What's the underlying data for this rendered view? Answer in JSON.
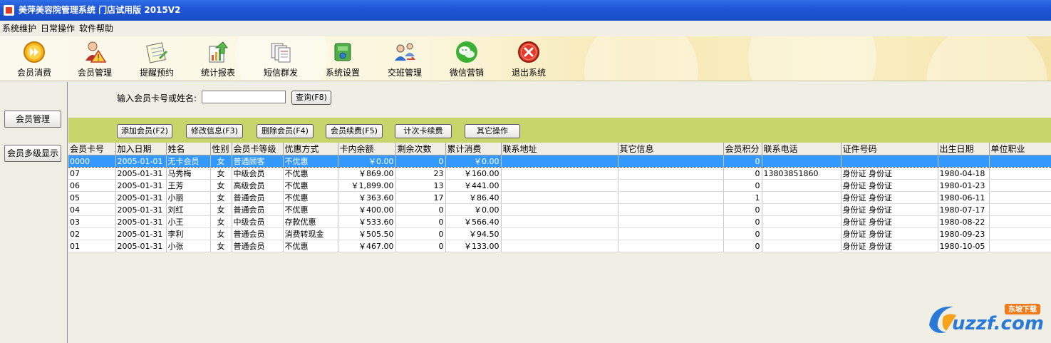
{
  "window": {
    "title": "美萍美容院管理系统 门店试用版  2015V2"
  },
  "menu": [
    "系统维护",
    "日常操作",
    "软件帮助"
  ],
  "toolbar": [
    {
      "label": "会员消费",
      "icon": "play-circle-icon"
    },
    {
      "label": "会员管理",
      "icon": "user-warning-icon"
    },
    {
      "label": "提醒预约",
      "icon": "notepad-icon"
    },
    {
      "label": "统计报表",
      "icon": "chart-arrow-icon"
    },
    {
      "label": "短信群发",
      "icon": "documents-stack-icon"
    },
    {
      "label": "系统设置",
      "icon": "settings-puzzle-icon"
    },
    {
      "label": "交班管理",
      "icon": "swap-users-icon"
    },
    {
      "label": "微信营销",
      "icon": "wechat-icon"
    },
    {
      "label": "退出系统",
      "icon": "close-circle-icon"
    }
  ],
  "sidebar": [
    "会员管理",
    "会员多级显示"
  ],
  "search": {
    "label": "输入会员卡号或姓名:",
    "value": "",
    "query_button": "查询(F8)"
  },
  "actions": [
    "添加会员(F2)",
    "修改信息(F3)",
    "删除会员(F4)",
    "会员续费(F5)",
    "计次卡续费",
    "其它操作"
  ],
  "table": {
    "columns": [
      "会员卡号",
      "加入日期",
      "姓名",
      "性别",
      "会员卡等级",
      "优惠方式",
      "卡内余额",
      "剩余次数",
      "累计消费",
      "联系地址",
      "其它信息",
      "会员积分",
      "联系电话",
      "证件号码",
      "出生日期",
      "单位职业"
    ],
    "rows": [
      [
        "0000",
        "2005-01-01",
        "无卡会员",
        "女",
        "普通顾客",
        "不优惠",
        "￥0.00",
        "0",
        "￥0.00",
        "",
        "",
        "0",
        "",
        "",
        "",
        ""
      ],
      [
        "07",
        "2005-01-31",
        "马秀梅",
        "女",
        "中级会员",
        "不优惠",
        "￥869.00",
        "23",
        "￥160.00",
        "",
        "",
        "0",
        "13803851860",
        "身份证 身份证",
        "1980-04-18",
        ""
      ],
      [
        "06",
        "2005-01-31",
        "王芳",
        "女",
        "高级会员",
        "不优惠",
        "￥1,899.00",
        "13",
        "￥441.00",
        "",
        "",
        "0",
        "",
        "身份证 身份证",
        "1980-01-23",
        ""
      ],
      [
        "05",
        "2005-01-31",
        "小丽",
        "女",
        "普通会员",
        "不优惠",
        "￥363.60",
        "17",
        "￥86.40",
        "",
        "",
        "1",
        "",
        "身份证 身份证",
        "1980-06-11",
        ""
      ],
      [
        "04",
        "2005-01-31",
        "刘红",
        "女",
        "普通会员",
        "不优惠",
        "￥400.00",
        "0",
        "￥0.00",
        "",
        "",
        "0",
        "",
        "身份证 身份证",
        "1980-07-17",
        ""
      ],
      [
        "03",
        "2005-01-31",
        "小王",
        "女",
        "中级会员",
        "存款优惠",
        "￥533.60",
        "0",
        "￥566.40",
        "",
        "",
        "0",
        "",
        "身份证 身份证",
        "1980-08-22",
        ""
      ],
      [
        "02",
        "2005-01-31",
        "李利",
        "女",
        "普通会员",
        "消费转现金",
        "￥505.50",
        "0",
        "￥94.50",
        "",
        "",
        "0",
        "",
        "身份证 身份证",
        "1980-09-23",
        ""
      ],
      [
        "01",
        "2005-01-31",
        "小张",
        "女",
        "普通会员",
        "不优惠",
        "￥467.00",
        "0",
        "￥133.00",
        "",
        "",
        "0",
        "",
        "身份证 身份证",
        "1980-10-05",
        ""
      ]
    ]
  },
  "watermark": {
    "brand": "uzzf.com",
    "tag": "东坡下载"
  },
  "colors": {
    "titlebar": "#1f56d6",
    "action_bar": "#c7d66a",
    "selected_row": "#3399ff"
  }
}
